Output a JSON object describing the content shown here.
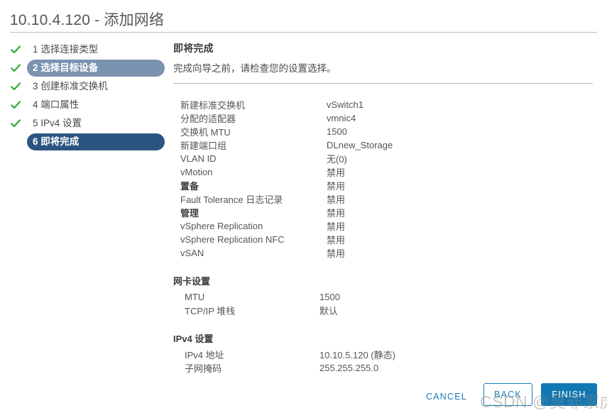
{
  "dialog": {
    "title": "10.10.4.120 - 添加网络"
  },
  "steps": [
    {
      "label": "1 选择连接类型",
      "state": "done"
    },
    {
      "label": "2 选择目标设备",
      "state": "visited"
    },
    {
      "label": "3 创建标准交换机",
      "state": "done"
    },
    {
      "label": "4 端口属性",
      "state": "done"
    },
    {
      "label": "5 IPv4 设置",
      "state": "done"
    },
    {
      "label": "6 即将完成",
      "state": "current"
    }
  ],
  "content": {
    "title": "即将完成",
    "subtitle": "完成向导之前，请检查您的设置选择。"
  },
  "summary": [
    {
      "label": "新建标准交换机",
      "value": "vSwitch1",
      "bold": false
    },
    {
      "label": "分配的适配器",
      "value": "vmnic4",
      "bold": false
    },
    {
      "label": "交换机 MTU",
      "value": "1500",
      "bold": false
    },
    {
      "label": "新建端口组",
      "value": "DLnew_Storage",
      "bold": false
    },
    {
      "label": "VLAN ID",
      "value": "无(0)",
      "bold": false
    },
    {
      "label": "vMotion",
      "value": "禁用",
      "bold": false
    },
    {
      "label": "置备",
      "value": "禁用",
      "bold": true
    },
    {
      "label": "Fault Tolerance 日志记录",
      "value": "禁用",
      "bold": false
    },
    {
      "label": "管理",
      "value": "禁用",
      "bold": true
    },
    {
      "label": "vSphere Replication",
      "value": "禁用",
      "bold": false
    },
    {
      "label": "vSphere Replication NFC",
      "value": "禁用",
      "bold": false
    },
    {
      "label": "vSAN",
      "value": "禁用",
      "bold": false
    }
  ],
  "sections": [
    {
      "heading": "网卡设置",
      "rows": [
        {
          "label": "MTU",
          "value": "1500"
        },
        {
          "label": "TCP/IP 堆栈",
          "value": "默认"
        }
      ]
    },
    {
      "heading": "IPv4 设置",
      "rows": [
        {
          "label": "IPv4 地址",
          "value": "10.10.5.120 (静态)"
        },
        {
          "label": "子网掩码",
          "value": "255.255.255.0"
        }
      ]
    }
  ],
  "footer": {
    "cancel_label": "CANCEL",
    "back_label": "BACK",
    "finish_label": "FINISH"
  },
  "watermark": {
    "text": "CSDN @莫非家虎"
  },
  "colors": {
    "accent": "#1278b3",
    "link": "#1a7bb9",
    "step_current": "#2b5580",
    "step_visited": "#7a93b0",
    "check": "#3aa43a"
  }
}
